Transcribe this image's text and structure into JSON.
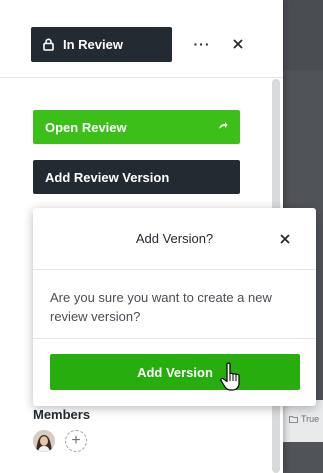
{
  "header": {
    "status_label": "In Review",
    "more_label": "···",
    "status_icon": "lock-icon",
    "close_icon": "close-icon"
  },
  "actions": {
    "open_review_label": "Open Review",
    "open_review_icon": "share-arrow-icon",
    "add_review_version_label": "Add Review Version"
  },
  "members": {
    "label": "Members",
    "add_label": "+"
  },
  "background": {
    "folder_label": "True"
  },
  "modal": {
    "title": "Add Version?",
    "body": "Are you sure you want to create a new review version?",
    "confirm_label": "Add Version",
    "close_icon": "close-icon"
  },
  "colors": {
    "dark": "#242a31",
    "green": "#3dbf1a",
    "confirm_green": "#27ae0e"
  }
}
